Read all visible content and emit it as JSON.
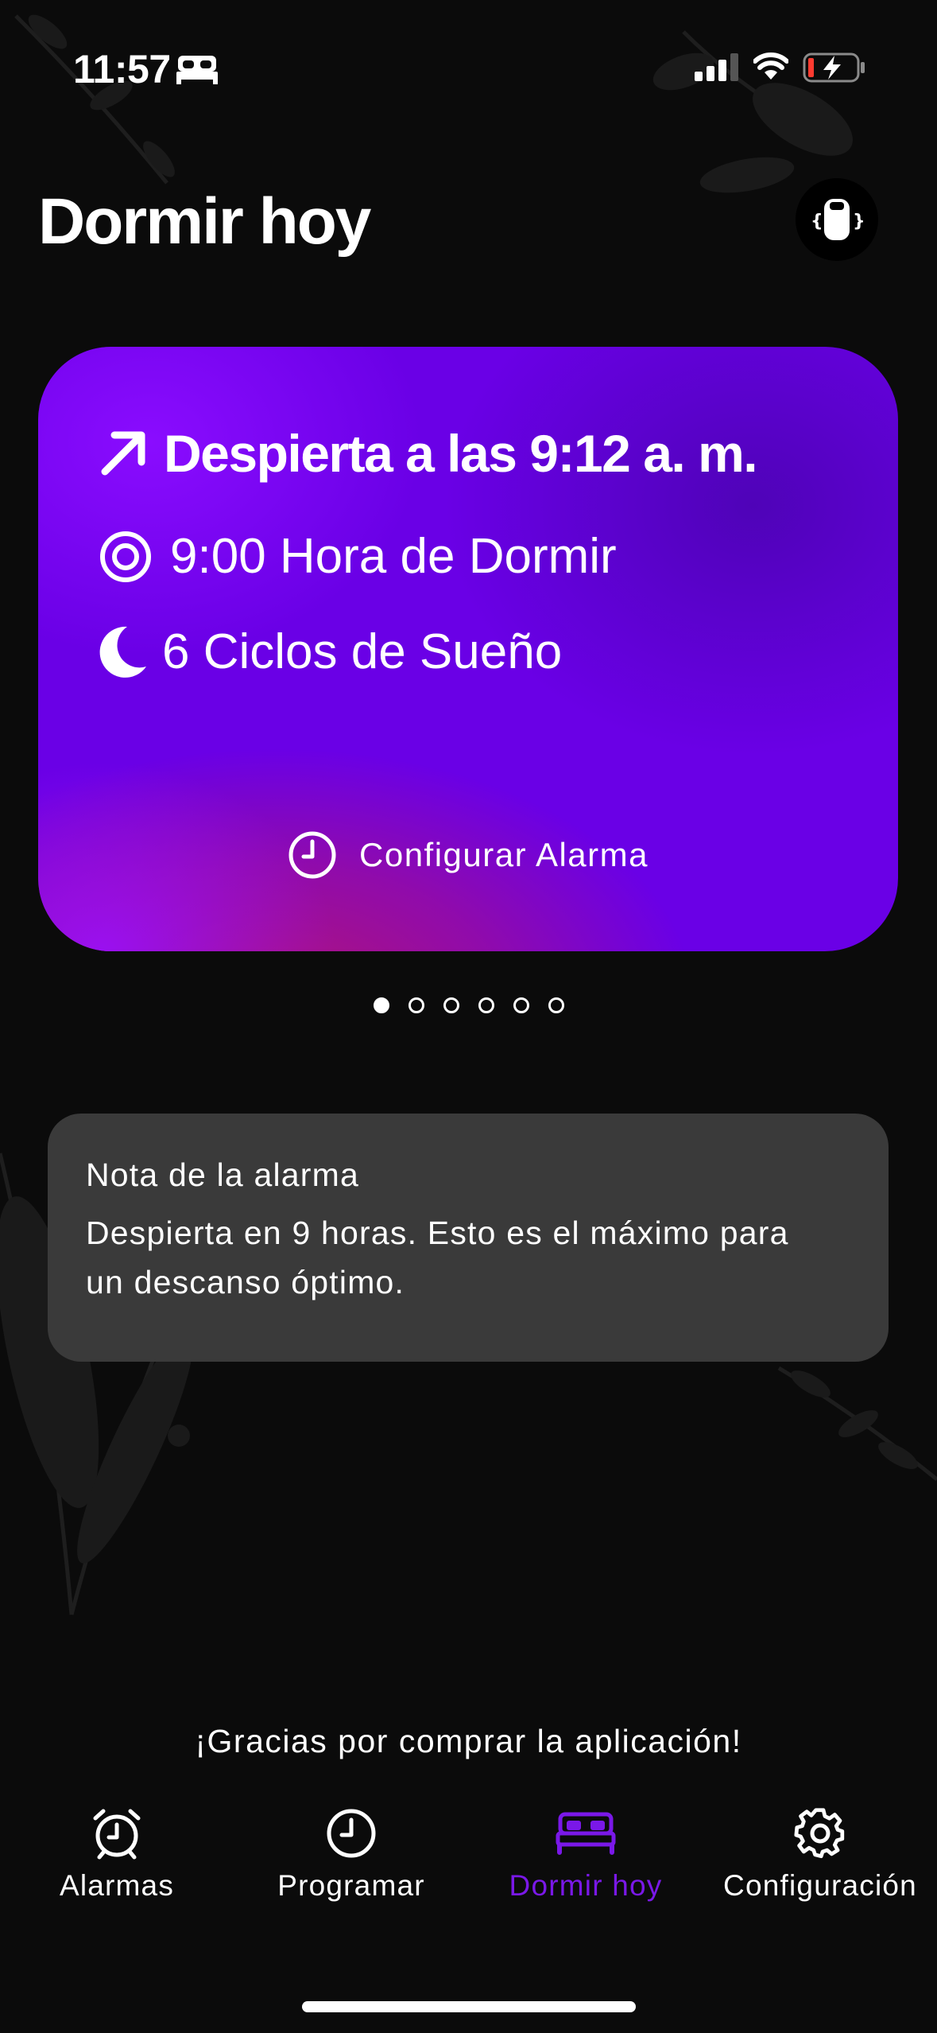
{
  "status_bar": {
    "time": "11:57"
  },
  "header": {
    "title": "Dormir hoy"
  },
  "card": {
    "wake_label": "Despierta a las 9:12 a. m.",
    "bedtime_label": "9:00 Hora de Dormir",
    "cycles_label": "6 Ciclos de Sueño",
    "configure_label": "Configurar Alarma"
  },
  "pager": {
    "total": 6,
    "current": 1
  },
  "note": {
    "title": "Nota de la alarma",
    "body_line1": "Despierta en 9 horas. Esto es el máximo para",
    "body_line2": "un descanso óptimo."
  },
  "thanks": "¡Gracias por comprar la aplicación!",
  "tabs": [
    {
      "label": "Alarmas",
      "icon": "alarm-clock-icon"
    },
    {
      "label": "Programar",
      "icon": "clock-icon"
    },
    {
      "label": "Dormir hoy",
      "icon": "bed-icon",
      "active": true
    },
    {
      "label": "Configuración",
      "icon": "gear-icon"
    }
  ],
  "colors": {
    "accent": "#7a18e8",
    "card_purple": "#6a00e6",
    "card_magenta": "#b0147a",
    "note_bg": "#3a3a3a",
    "background": "#0b0b0b"
  }
}
